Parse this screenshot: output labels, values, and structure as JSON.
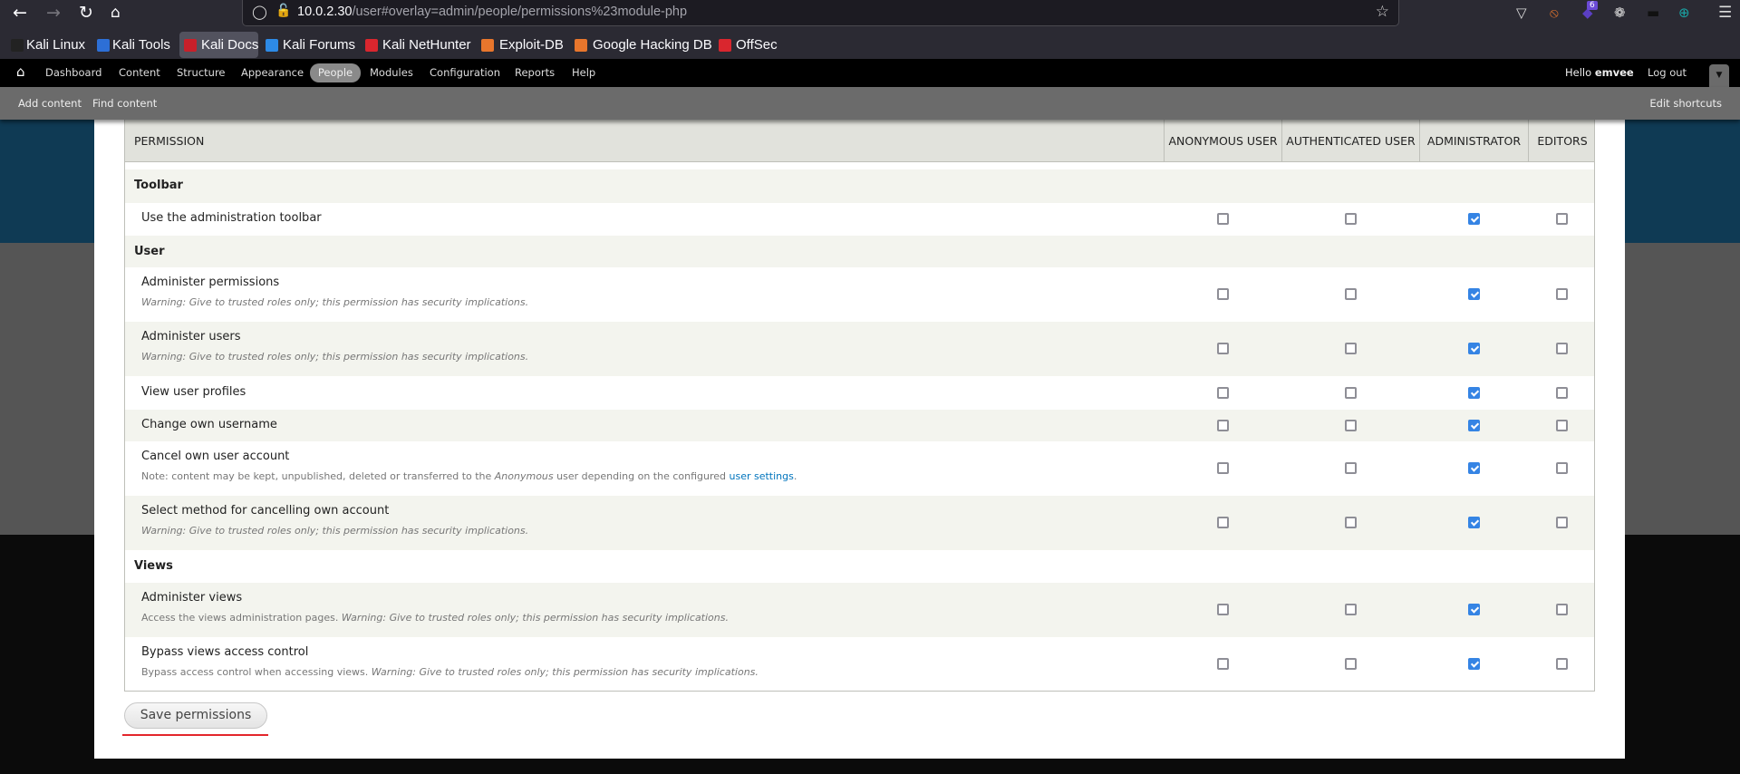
{
  "browser": {
    "url_host": "10.0.2.30",
    "url_rest": "/user#overlay=admin/people/permissions%23module-php",
    "extension_badge": "6",
    "bookmarks": [
      {
        "label": "Kali Linux",
        "color": "#222"
      },
      {
        "label": "Kali Tools",
        "color": "#2d6fd6"
      },
      {
        "label": "Kali Docs",
        "color": "#c8202a"
      },
      {
        "label": "Kali Forums",
        "color": "#2d8ae6"
      },
      {
        "label": "Kali NetHunter",
        "color": "#d9262e"
      },
      {
        "label": "Exploit-DB",
        "color": "#e8762c"
      },
      {
        "label": "Google Hacking DB",
        "color": "#e8762c"
      },
      {
        "label": "OffSec",
        "color": "#d9262e"
      }
    ]
  },
  "toolbar": {
    "items": [
      "Dashboard",
      "Content",
      "Structure",
      "Appearance",
      "People",
      "Modules",
      "Configuration",
      "Reports",
      "Help"
    ],
    "active": "People",
    "hello": "Hello ",
    "user": "emvee",
    "logout": "Log out"
  },
  "shortcuts": {
    "add": "Add content",
    "find": "Find content",
    "edit": "Edit shortcuts"
  },
  "table": {
    "headers": [
      "PERMISSION",
      "ANONYMOUS USER",
      "AUTHENTICATED USER",
      "ADMINISTRATOR",
      "EDITORS"
    ],
    "rows": [
      {
        "group": "Toolbar"
      },
      {
        "label": "Use the administration toolbar",
        "checks": [
          false,
          false,
          true,
          false
        ]
      },
      {
        "group": "User"
      },
      {
        "label": "Administer permissions",
        "desc": [
          {
            "t": "Warning: Give to trusted roles only; this permission has security implications.",
            "s": "i"
          }
        ],
        "checks": [
          false,
          false,
          true,
          false
        ]
      },
      {
        "label": "Administer users",
        "desc": [
          {
            "t": "Warning: Give to trusted roles only; this permission has security implications.",
            "s": "i"
          }
        ],
        "checks": [
          false,
          false,
          true,
          false
        ]
      },
      {
        "label": "View user profiles",
        "checks": [
          false,
          false,
          true,
          false
        ]
      },
      {
        "label": "Change own username",
        "checks": [
          false,
          false,
          true,
          false
        ]
      },
      {
        "label": "Cancel own user account",
        "desc": [
          {
            "t": "Note: content may be kept, unpublished, deleted or transferred to the ",
            "s": "p"
          },
          {
            "t": "Anonymous",
            "s": "i"
          },
          {
            "t": " user depending on the configured ",
            "s": "p"
          },
          {
            "t": "user settings",
            "s": "a"
          },
          {
            "t": ".",
            "s": "p"
          }
        ],
        "checks": [
          false,
          false,
          true,
          false
        ]
      },
      {
        "label": "Select method for cancelling own account",
        "desc": [
          {
            "t": "Warning: Give to trusted roles only; this permission has security implications.",
            "s": "i"
          }
        ],
        "checks": [
          false,
          false,
          true,
          false
        ]
      },
      {
        "group": "Views"
      },
      {
        "label": "Administer views",
        "desc": [
          {
            "t": "Access the views administration pages. ",
            "s": "p"
          },
          {
            "t": "Warning: Give to trusted roles only; this permission has security implications.",
            "s": "i"
          }
        ],
        "checks": [
          false,
          false,
          true,
          false
        ]
      },
      {
        "label": "Bypass views access control",
        "desc": [
          {
            "t": "Bypass access control when accessing views. ",
            "s": "p"
          },
          {
            "t": "Warning: Give to trusted roles only; this permission has security implications.",
            "s": "i"
          }
        ],
        "checks": [
          false,
          false,
          true,
          false
        ]
      }
    ]
  },
  "save_label": "Save permissions",
  "colors": {
    "accent": "#3584e4",
    "highlight_underline": "#e3262b",
    "link": "#0074bd"
  }
}
